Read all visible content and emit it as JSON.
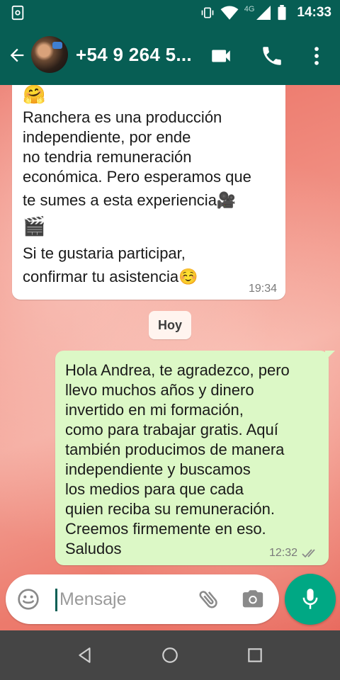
{
  "status_bar": {
    "network": "4G",
    "time": "14:33"
  },
  "header": {
    "contact_name": "+54 9 264 5...",
    "icons": [
      "back-arrow-icon",
      "avatar",
      "video-call-icon",
      "phone-icon",
      "more-vert-icon"
    ]
  },
  "messages": {
    "incoming": {
      "emoji_top": "🤗",
      "lines": [
        "Ranchera es una producción",
        "independiente, por ende",
        "no tendria remuneración",
        "económica. Pero esperamos que",
        "te sumes a esta experiencia🎥",
        "🎬",
        "Si te gustaria participar,",
        "confirmar tu asistencia☺️"
      ],
      "time": "19:34"
    },
    "date_chip": "Hoy",
    "outgoing": {
      "lines": [
        "Hola Andrea, te agradezco, pero",
        "llevo muchos años y dinero",
        "invertido en mi formación,",
        "como para trabajar gratis. Aquí",
        "también producimos de manera",
        "independiente y buscamos",
        "los medios para que cada",
        "quien reciba su remuneración.",
        "Creemos firmemente en eso.",
        "Saludos"
      ],
      "time": "12:32",
      "status": "double-check-icon"
    }
  },
  "composer": {
    "placeholder": "Mensaje"
  },
  "colors": {
    "header": "#075E54",
    "outgoing_bubble": "#dcf8c6",
    "mic_button": "#00a884"
  }
}
